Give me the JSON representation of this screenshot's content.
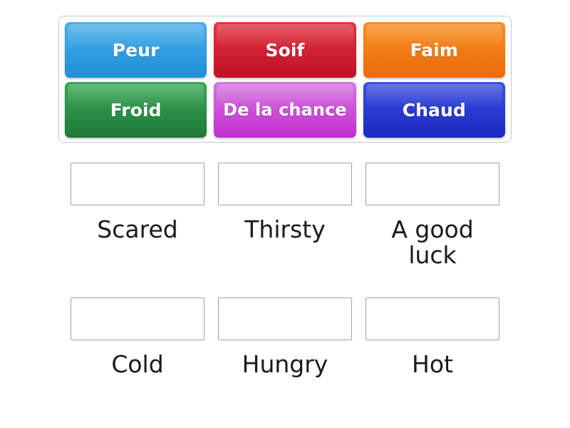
{
  "activity": {
    "type": "drag-and-drop-matching",
    "tile_bank": {
      "tiles": [
        {
          "label": "Peur",
          "color_top": "#4aaeea",
          "color_bottom": "#1e8fd8",
          "color_name": "blue"
        },
        {
          "label": "Soif",
          "color_top": "#e23440",
          "color_bottom": "#c01028",
          "color_name": "red"
        },
        {
          "label": "Faim",
          "color_top": "#f98e21",
          "color_bottom": "#ea6a0a",
          "color_name": "orange"
        },
        {
          "label": "Froid",
          "color_top": "#3aa856",
          "color_bottom": "#1e7a38",
          "color_name": "green"
        },
        {
          "label": "De la chance",
          "color_top": "#d573e0",
          "color_bottom": "#c12fd0",
          "color_name": "magenta"
        },
        {
          "label": "Chaud",
          "color_top": "#3a50e0",
          "color_bottom": "#1a28c0",
          "color_name": "dark-blue"
        }
      ]
    },
    "answers": {
      "rows": [
        [
          {
            "label": "Scared",
            "dropped_tile": ""
          },
          {
            "label": "Thirsty",
            "dropped_tile": ""
          },
          {
            "label": "A good luck",
            "dropped_tile": ""
          }
        ],
        [
          {
            "label": "Cold",
            "dropped_tile": ""
          },
          {
            "label": "Hungry",
            "dropped_tile": ""
          },
          {
            "label": "Hot",
            "dropped_tile": ""
          }
        ]
      ]
    }
  }
}
